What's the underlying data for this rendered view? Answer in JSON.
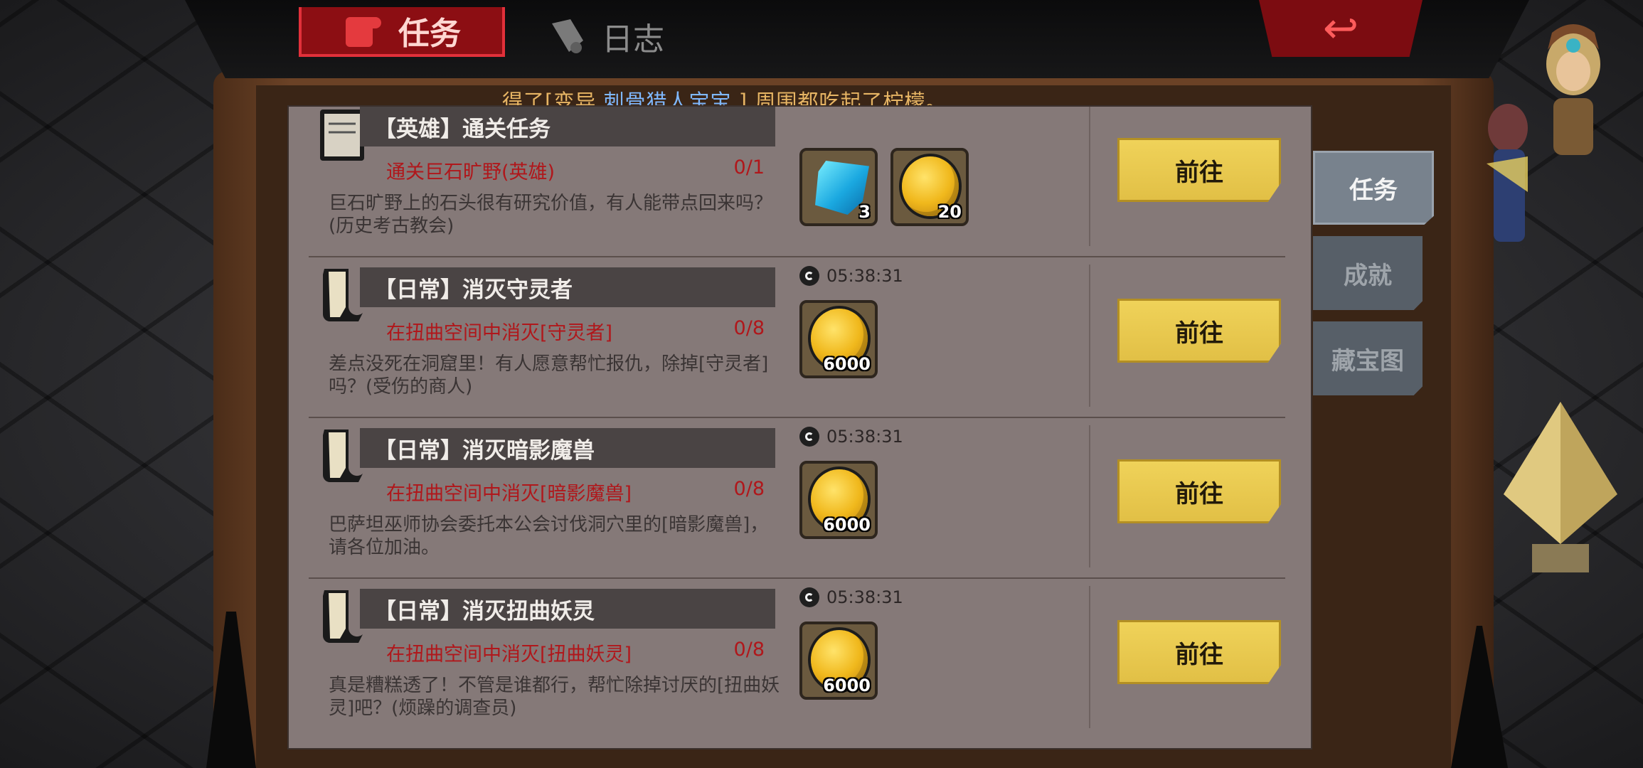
{
  "tabs": {
    "quest": "任务",
    "log": "日志"
  },
  "notification": {
    "prefix": "得了[变异 ",
    "highlight": "刺骨猎人宝宝",
    "suffix": " ],周围都吃起了柠檬。"
  },
  "side_tabs": [
    "任务",
    "成就",
    "藏宝图"
  ],
  "go_label": "前往",
  "quests": [
    {
      "title": "【英雄】通关任务",
      "objective": "通关巨石旷野(英雄)",
      "progress": "0/1",
      "description": "巨石旷野上的石头很有研究价值，有人能带点回来吗？(历史考古教会)",
      "timer": "",
      "icon": "book-icon",
      "rewards": [
        {
          "type": "gem-icon",
          "qty": "3"
        },
        {
          "type": "coin-icon",
          "qty": "20"
        }
      ]
    },
    {
      "title": "【日常】消灭守灵者",
      "objective": "在扭曲空间中消灭[守灵者]",
      "progress": "0/8",
      "description": "差点没死在洞窟里！有人愿意帮忙报仇，除掉[守灵者]吗？(受伤的商人)",
      "timer": "05:38:31",
      "icon": "scroll-icon",
      "rewards": [
        {
          "type": "coin-icon",
          "qty": "6000"
        }
      ]
    },
    {
      "title": "【日常】消灭暗影魔兽",
      "objective": "在扭曲空间中消灭[暗影魔兽]",
      "progress": "0/8",
      "description": "巴萨坦巫师协会委托本公会讨伐洞穴里的[暗影魔兽]，请各位加油。",
      "timer": "05:38:31",
      "icon": "scroll-icon",
      "rewards": [
        {
          "type": "coin-icon",
          "qty": "6000"
        }
      ]
    },
    {
      "title": "【日常】消灭扭曲妖灵",
      "objective": "在扭曲空间中消灭[扭曲妖灵]",
      "progress": "0/8",
      "description": "真是糟糕透了！不管是谁都行，帮忙除掉讨厌的[扭曲妖灵]吧？(烦躁的调查员)",
      "timer": "05:38:31",
      "icon": "scroll-icon",
      "rewards": [
        {
          "type": "coin-icon",
          "qty": "6000"
        }
      ]
    }
  ],
  "colors": {
    "panel": "#857978",
    "go_button": "#e8c84d",
    "objective": "#b0171b",
    "tab_active": "#8c0e13"
  }
}
